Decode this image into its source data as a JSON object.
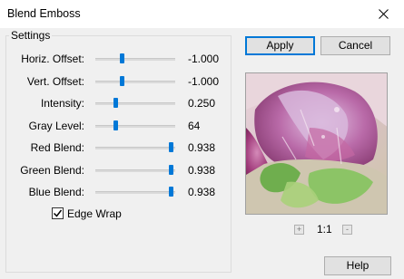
{
  "window": {
    "title": "Blend Emboss",
    "close_icon": "close-icon"
  },
  "settings": {
    "group_label": "Settings",
    "sliders": [
      {
        "label": "Horiz. Offset:",
        "value": "-1.000",
        "level": 0.33
      },
      {
        "label": "Vert. Offset:",
        "value": "-1.000",
        "level": 0.33
      },
      {
        "label": "Intensity:",
        "value": "0.250",
        "level": 0.25
      },
      {
        "label": "Gray Level:",
        "value": "64",
        "level": 0.25
      },
      {
        "label": "Red Blend:",
        "value": "0.938",
        "level": 0.938
      },
      {
        "label": "Green Blend:",
        "value": "0.938",
        "level": 0.938
      },
      {
        "label": "Blue Blend:",
        "value": "0.938",
        "level": 0.938
      }
    ],
    "edge_wrap": {
      "label": "Edge Wrap",
      "checked": true
    }
  },
  "buttons": {
    "apply": "Apply",
    "cancel": "Cancel",
    "help": "Help"
  },
  "preview": {
    "zoom_label": "1:1",
    "zoom_in": "+",
    "zoom_out": "-"
  },
  "colors": {
    "accent": "#0078d7"
  }
}
